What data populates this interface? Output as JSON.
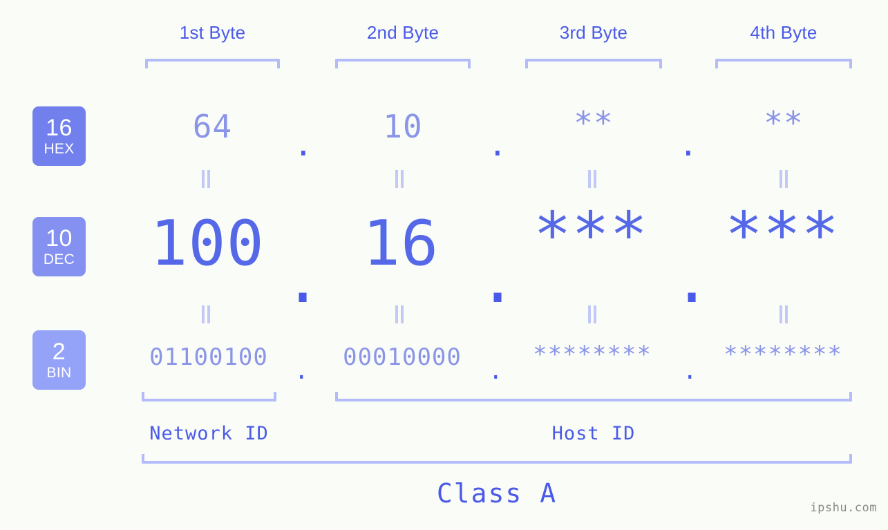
{
  "background_color": "#fafcf7",
  "accent_color": "#4a5ae8",
  "accent_light_color": "#8b95e8",
  "bracket_color": "#b3bcf9",
  "byte_headers": [
    {
      "label": "1st Byte"
    },
    {
      "label": "2nd Byte"
    },
    {
      "label": "3rd Byte"
    },
    {
      "label": "4th Byte"
    }
  ],
  "bases": [
    {
      "num": "16",
      "name": "HEX",
      "color": "#7180ec"
    },
    {
      "num": "10",
      "name": "DEC",
      "color": "#8491f1"
    },
    {
      "num": "2",
      "name": "BIN",
      "color": "#94a3f8"
    }
  ],
  "rows": {
    "hex": {
      "values": [
        "64",
        "10",
        "**",
        "**"
      ],
      "separator": "."
    },
    "dec": {
      "values": [
        "100",
        "16",
        "***",
        "***"
      ],
      "separator": "."
    },
    "bin": {
      "values": [
        "01100100",
        "00010000",
        "********",
        "********"
      ],
      "separator": "."
    }
  },
  "segments": {
    "network_id": "Network ID",
    "host_id": "Host ID"
  },
  "class_label": "Class A",
  "watermark": "ipshu.com"
}
